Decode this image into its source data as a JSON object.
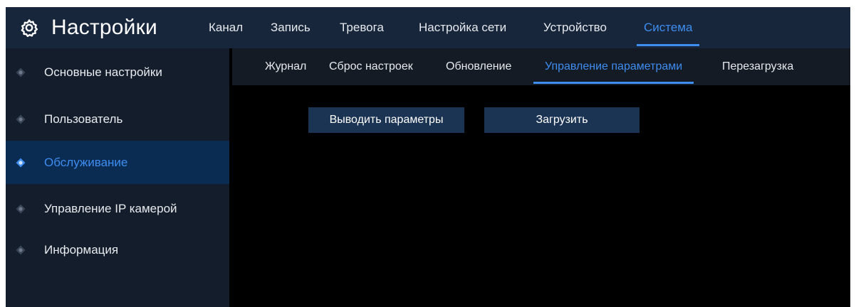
{
  "header": {
    "title": "Настройки",
    "icon": "gear-icon",
    "nav": [
      "Канал",
      "Запись",
      "Тревога",
      "Настройка сети",
      "Устройство",
      "Система"
    ],
    "active_nav": "Система"
  },
  "sidebar": {
    "items": [
      {
        "label": "Основные настройки",
        "icon": "diamond-icon"
      },
      {
        "label": "Пользователь",
        "icon": "diamond-icon"
      },
      {
        "label": "Обслуживание",
        "icon": "diamond-icon",
        "active": true
      },
      {
        "label": "Управление IP камерой",
        "icon": "diamond-icon"
      },
      {
        "label": "Информация",
        "icon": "diamond-icon"
      }
    ]
  },
  "subtabs": {
    "items": [
      "Журнал",
      "Сброс настроек",
      "Обновление",
      "Управление параметрами",
      "Перезагрузка"
    ],
    "active": "Управление параметрами"
  },
  "content": {
    "export_button": "Выводить параметры",
    "load_button": "Загрузить"
  },
  "colors": {
    "accent": "#3e8df0",
    "header_bg": "#17263a",
    "sidebar_bg": "#141d2b",
    "sidebar_active_bg": "#0a2b52",
    "button_bg": "#1b3453"
  }
}
